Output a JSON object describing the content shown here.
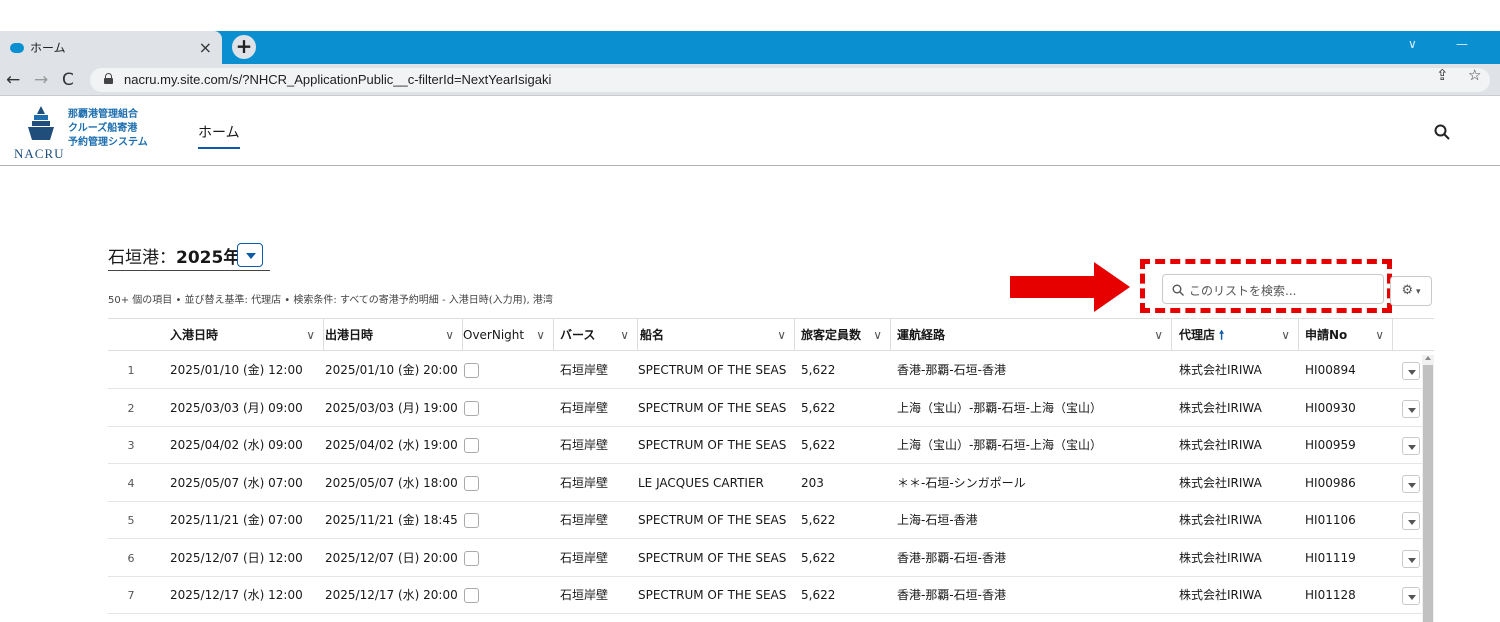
{
  "browser": {
    "tab_title": "ホーム",
    "tab_close": "×",
    "new_tab": "+",
    "url": "nacru.my.site.com/s/?NHCR_ApplicationPublic__c-filterId=NextYearIsigaki"
  },
  "site": {
    "logo_text": "NACRU",
    "logo_lines": [
      "那覇港管理組合",
      "クルーズ船寄港",
      "予約管理システム"
    ],
    "nav_home": "ホーム"
  },
  "listview": {
    "title_prefix": "石垣港：",
    "title_year": "2025年",
    "meta": "50+ 個の項目 • 並び替え基準: 代理店 • 検索条件: すべての寄港予約明細 - 入港日時(入力用), 港湾",
    "search_placeholder": "このリストを検索...",
    "highlight_color": "#e60000"
  },
  "table": {
    "columns": [
      "入港日時",
      "出港日時",
      "OverNight",
      "バース",
      "船名",
      "旅客定員数",
      "運航経路",
      "代理店",
      "申請No"
    ],
    "sorted_column": "代理店",
    "sort_direction": "asc",
    "rows": [
      {
        "n": "1",
        "arrive": "2025/01/10 (金) 12:00",
        "depart": "2025/01/10 (金) 20:00",
        "berth": "石垣岸壁",
        "ship": "SPECTRUM OF THE SEAS",
        "capacity": "5,622",
        "route": "香港-那覇-石垣-香港",
        "agent": "株式会社IRIWA",
        "app": "HI00894"
      },
      {
        "n": "2",
        "arrive": "2025/03/03 (月) 09:00",
        "depart": "2025/03/03 (月) 19:00",
        "berth": "石垣岸壁",
        "ship": "SPECTRUM OF THE SEAS",
        "capacity": "5,622",
        "route": "上海（宝山）-那覇-石垣-上海（宝山）",
        "agent": "株式会社IRIWA",
        "app": "HI00930"
      },
      {
        "n": "3",
        "arrive": "2025/04/02 (水) 09:00",
        "depart": "2025/04/02 (水) 19:00",
        "berth": "石垣岸壁",
        "ship": "SPECTRUM OF THE SEAS",
        "capacity": "5,622",
        "route": "上海（宝山）-那覇-石垣-上海（宝山）",
        "agent": "株式会社IRIWA",
        "app": "HI00959"
      },
      {
        "n": "4",
        "arrive": "2025/05/07 (水) 07:00",
        "depart": "2025/05/07 (水) 18:00",
        "berth": "石垣岸壁",
        "ship": "LE JACQUES CARTIER",
        "capacity": "203",
        "route": "＊＊-石垣-シンガポール",
        "agent": "株式会社IRIWA",
        "app": "HI00986"
      },
      {
        "n": "5",
        "arrive": "2025/11/21 (金) 07:00",
        "depart": "2025/11/21 (金) 18:45",
        "berth": "石垣岸壁",
        "ship": "SPECTRUM OF THE SEAS",
        "capacity": "5,622",
        "route": "上海-石垣-香港",
        "agent": "株式会社IRIWA",
        "app": "HI01106"
      },
      {
        "n": "6",
        "arrive": "2025/12/07 (日) 12:00",
        "depart": "2025/12/07 (日) 20:00",
        "berth": "石垣岸壁",
        "ship": "SPECTRUM OF THE SEAS",
        "capacity": "5,622",
        "route": "香港-那覇-石垣-香港",
        "agent": "株式会社IRIWA",
        "app": "HI01119"
      },
      {
        "n": "7",
        "arrive": "2025/12/17 (水) 12:00",
        "depart": "2025/12/17 (水) 20:00",
        "berth": "石垣岸壁",
        "ship": "SPECTRUM OF THE SEAS",
        "capacity": "5,622",
        "route": "香港-那覇-石垣-香港",
        "agent": "株式会社IRIWA",
        "app": "HI01128"
      }
    ]
  }
}
